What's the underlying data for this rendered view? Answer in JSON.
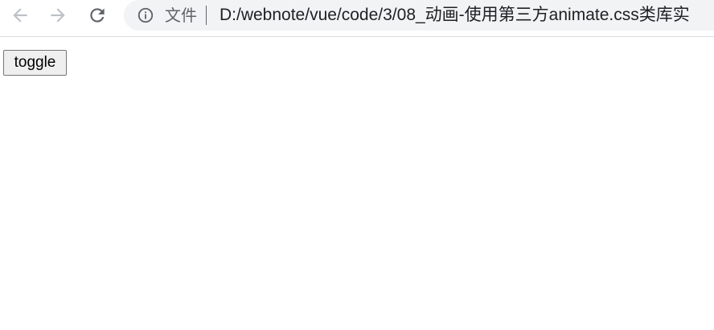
{
  "browser": {
    "nav": {
      "back_icon": "arrow-left-icon",
      "forward_icon": "arrow-right-icon",
      "reload_icon": "reload-icon"
    },
    "omnibox": {
      "info_icon": "info-icon",
      "scheme_label": "文件",
      "url": "D:/webnote/vue/code/3/08_动画-使用第三方animate.css类库实"
    }
  },
  "page": {
    "toggle_label": "toggle"
  },
  "colors": {
    "toolbar_bg": "#ffffff",
    "omnibox_bg": "#f1f3f4",
    "icon_gray": "#5f6368",
    "disabled_icon": "#bdc1c6",
    "url_text": "#202124",
    "button_bg": "#efefef",
    "button_border": "#767676"
  }
}
